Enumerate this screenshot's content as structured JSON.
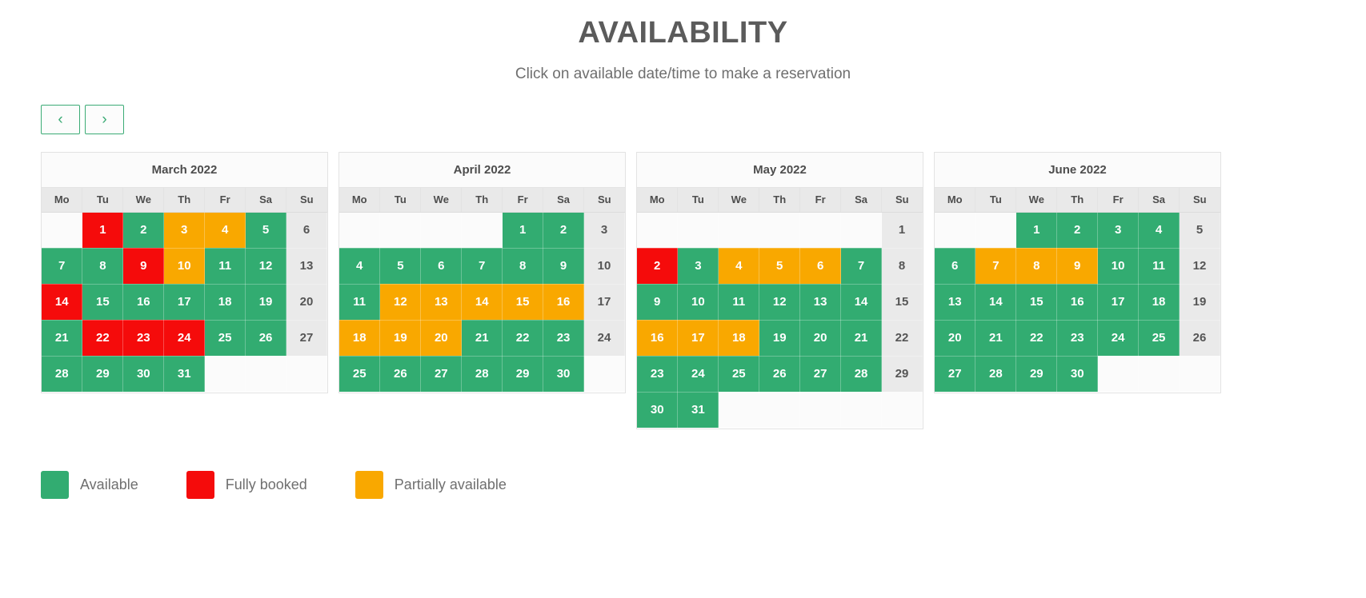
{
  "header": {
    "title": "AVAILABILITY",
    "subtitle": "Click on available date/time to make a reservation"
  },
  "nav": {
    "prev_label": "‹",
    "next_label": "›",
    "prev_name": "chevron-left-icon",
    "next_name": "chevron-right-icon"
  },
  "weekday_headers": [
    "Mo",
    "Tu",
    "We",
    "Th",
    "Fr",
    "Sa",
    "Su"
  ],
  "status_colors": {
    "available": "#32ac71",
    "fully_booked": "#f50b0b",
    "partially_available": "#f9a800",
    "disabled": "#eaeaea",
    "empty": "#fbfbfb"
  },
  "legend": [
    {
      "label": "Available",
      "color": "#32ac71",
      "status": "available"
    },
    {
      "label": "Fully booked",
      "color": "#f50b0b",
      "status": "booked"
    },
    {
      "label": "Partially available",
      "color": "#f9a800",
      "status": "partial"
    }
  ],
  "calendars": [
    {
      "title": "March 2022",
      "weeks": [
        [
          {
            "day": "",
            "status": "empty"
          },
          {
            "day": "1",
            "status": "booked"
          },
          {
            "day": "2",
            "status": "available"
          },
          {
            "day": "3",
            "status": "partial"
          },
          {
            "day": "4",
            "status": "partial"
          },
          {
            "day": "5",
            "status": "available"
          },
          {
            "day": "6",
            "status": "disabled"
          }
        ],
        [
          {
            "day": "7",
            "status": "available"
          },
          {
            "day": "8",
            "status": "available"
          },
          {
            "day": "9",
            "status": "booked"
          },
          {
            "day": "10",
            "status": "partial"
          },
          {
            "day": "11",
            "status": "available"
          },
          {
            "day": "12",
            "status": "available"
          },
          {
            "day": "13",
            "status": "disabled"
          }
        ],
        [
          {
            "day": "14",
            "status": "booked"
          },
          {
            "day": "15",
            "status": "available"
          },
          {
            "day": "16",
            "status": "available"
          },
          {
            "day": "17",
            "status": "available"
          },
          {
            "day": "18",
            "status": "available"
          },
          {
            "day": "19",
            "status": "available"
          },
          {
            "day": "20",
            "status": "disabled"
          }
        ],
        [
          {
            "day": "21",
            "status": "available"
          },
          {
            "day": "22",
            "status": "booked"
          },
          {
            "day": "23",
            "status": "booked"
          },
          {
            "day": "24",
            "status": "booked"
          },
          {
            "day": "25",
            "status": "available"
          },
          {
            "day": "26",
            "status": "available"
          },
          {
            "day": "27",
            "status": "disabled"
          }
        ],
        [
          {
            "day": "28",
            "status": "available"
          },
          {
            "day": "29",
            "status": "available"
          },
          {
            "day": "30",
            "status": "available"
          },
          {
            "day": "31",
            "status": "available"
          },
          {
            "day": "",
            "status": "empty"
          },
          {
            "day": "",
            "status": "empty"
          },
          {
            "day": "",
            "status": "empty"
          }
        ]
      ]
    },
    {
      "title": "April 2022",
      "weeks": [
        [
          {
            "day": "",
            "status": "empty"
          },
          {
            "day": "",
            "status": "empty"
          },
          {
            "day": "",
            "status": "empty"
          },
          {
            "day": "",
            "status": "empty"
          },
          {
            "day": "1",
            "status": "available"
          },
          {
            "day": "2",
            "status": "available"
          },
          {
            "day": "3",
            "status": "disabled"
          }
        ],
        [
          {
            "day": "4",
            "status": "available"
          },
          {
            "day": "5",
            "status": "available"
          },
          {
            "day": "6",
            "status": "available"
          },
          {
            "day": "7",
            "status": "available"
          },
          {
            "day": "8",
            "status": "available"
          },
          {
            "day": "9",
            "status": "available"
          },
          {
            "day": "10",
            "status": "disabled"
          }
        ],
        [
          {
            "day": "11",
            "status": "available"
          },
          {
            "day": "12",
            "status": "partial"
          },
          {
            "day": "13",
            "status": "partial"
          },
          {
            "day": "14",
            "status": "partial"
          },
          {
            "day": "15",
            "status": "partial"
          },
          {
            "day": "16",
            "status": "partial"
          },
          {
            "day": "17",
            "status": "disabled"
          }
        ],
        [
          {
            "day": "18",
            "status": "partial"
          },
          {
            "day": "19",
            "status": "partial"
          },
          {
            "day": "20",
            "status": "partial"
          },
          {
            "day": "21",
            "status": "available"
          },
          {
            "day": "22",
            "status": "available"
          },
          {
            "day": "23",
            "status": "available"
          },
          {
            "day": "24",
            "status": "disabled"
          }
        ],
        [
          {
            "day": "25",
            "status": "available"
          },
          {
            "day": "26",
            "status": "available"
          },
          {
            "day": "27",
            "status": "available"
          },
          {
            "day": "28",
            "status": "available"
          },
          {
            "day": "29",
            "status": "available"
          },
          {
            "day": "30",
            "status": "available"
          },
          {
            "day": "",
            "status": "empty"
          }
        ]
      ]
    },
    {
      "title": "May 2022",
      "weeks": [
        [
          {
            "day": "",
            "status": "empty"
          },
          {
            "day": "",
            "status": "empty"
          },
          {
            "day": "",
            "status": "empty"
          },
          {
            "day": "",
            "status": "empty"
          },
          {
            "day": "",
            "status": "empty"
          },
          {
            "day": "",
            "status": "empty"
          },
          {
            "day": "1",
            "status": "disabled"
          }
        ],
        [
          {
            "day": "2",
            "status": "booked"
          },
          {
            "day": "3",
            "status": "available"
          },
          {
            "day": "4",
            "status": "partial"
          },
          {
            "day": "5",
            "status": "partial"
          },
          {
            "day": "6",
            "status": "partial"
          },
          {
            "day": "7",
            "status": "available"
          },
          {
            "day": "8",
            "status": "disabled"
          }
        ],
        [
          {
            "day": "9",
            "status": "available"
          },
          {
            "day": "10",
            "status": "available"
          },
          {
            "day": "11",
            "status": "available"
          },
          {
            "day": "12",
            "status": "available"
          },
          {
            "day": "13",
            "status": "available"
          },
          {
            "day": "14",
            "status": "available"
          },
          {
            "day": "15",
            "status": "disabled"
          }
        ],
        [
          {
            "day": "16",
            "status": "partial"
          },
          {
            "day": "17",
            "status": "partial"
          },
          {
            "day": "18",
            "status": "partial"
          },
          {
            "day": "19",
            "status": "available"
          },
          {
            "day": "20",
            "status": "available"
          },
          {
            "day": "21",
            "status": "available"
          },
          {
            "day": "22",
            "status": "disabled"
          }
        ],
        [
          {
            "day": "23",
            "status": "available"
          },
          {
            "day": "24",
            "status": "available"
          },
          {
            "day": "25",
            "status": "available"
          },
          {
            "day": "26",
            "status": "available"
          },
          {
            "day": "27",
            "status": "available"
          },
          {
            "day": "28",
            "status": "available"
          },
          {
            "day": "29",
            "status": "disabled"
          }
        ],
        [
          {
            "day": "30",
            "status": "available"
          },
          {
            "day": "31",
            "status": "available"
          },
          {
            "day": "",
            "status": "empty"
          },
          {
            "day": "",
            "status": "empty"
          },
          {
            "day": "",
            "status": "empty"
          },
          {
            "day": "",
            "status": "empty"
          },
          {
            "day": "",
            "status": "empty"
          }
        ]
      ]
    },
    {
      "title": "June 2022",
      "weeks": [
        [
          {
            "day": "",
            "status": "empty"
          },
          {
            "day": "",
            "status": "empty"
          },
          {
            "day": "1",
            "status": "available"
          },
          {
            "day": "2",
            "status": "available"
          },
          {
            "day": "3",
            "status": "available"
          },
          {
            "day": "4",
            "status": "available"
          },
          {
            "day": "5",
            "status": "disabled"
          }
        ],
        [
          {
            "day": "6",
            "status": "available"
          },
          {
            "day": "7",
            "status": "partial"
          },
          {
            "day": "8",
            "status": "partial"
          },
          {
            "day": "9",
            "status": "partial"
          },
          {
            "day": "10",
            "status": "available"
          },
          {
            "day": "11",
            "status": "available"
          },
          {
            "day": "12",
            "status": "disabled"
          }
        ],
        [
          {
            "day": "13",
            "status": "available"
          },
          {
            "day": "14",
            "status": "available"
          },
          {
            "day": "15",
            "status": "available"
          },
          {
            "day": "16",
            "status": "available"
          },
          {
            "day": "17",
            "status": "available"
          },
          {
            "day": "18",
            "status": "available"
          },
          {
            "day": "19",
            "status": "disabled"
          }
        ],
        [
          {
            "day": "20",
            "status": "available"
          },
          {
            "day": "21",
            "status": "available"
          },
          {
            "day": "22",
            "status": "available"
          },
          {
            "day": "23",
            "status": "available"
          },
          {
            "day": "24",
            "status": "available"
          },
          {
            "day": "25",
            "status": "available"
          },
          {
            "day": "26",
            "status": "disabled"
          }
        ],
        [
          {
            "day": "27",
            "status": "available"
          },
          {
            "day": "28",
            "status": "available"
          },
          {
            "day": "29",
            "status": "available"
          },
          {
            "day": "30",
            "status": "available"
          },
          {
            "day": "",
            "status": "empty"
          },
          {
            "day": "",
            "status": "empty"
          },
          {
            "day": "",
            "status": "empty"
          }
        ]
      ]
    }
  ]
}
